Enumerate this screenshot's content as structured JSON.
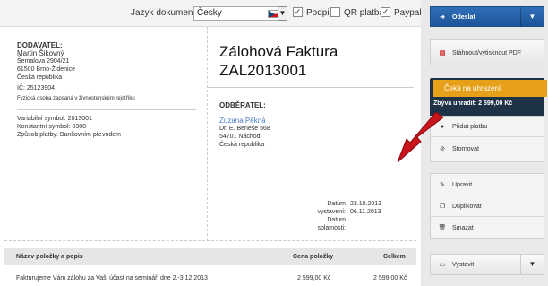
{
  "toolbar": {
    "language_label": "Jazyk dokumentu",
    "language_value": "Česky",
    "signature_label": "Podpis",
    "qr_label": "QR platba",
    "paypal_label": "Paypal"
  },
  "supplier": {
    "heading": "DODAVATEL:",
    "name": "Martin Šikovný",
    "street": "Šemalova 2904/21",
    "city": "61500 Brno-Židenice",
    "country": "Česká republika",
    "ic": "IČ: 25123904",
    "note": "Fyzická osoba zapsaná v živnostenském rejstříku"
  },
  "payment": {
    "variable": "Variabilní symbol: 2013001",
    "constant": "Konstantní symbol: 0308",
    "method": "Způsob platby: Bankovním převodem"
  },
  "invoice": {
    "title": "Zálohová Faktura",
    "number": "ZAL2013001"
  },
  "customer": {
    "heading": "ODBĚRATEL:",
    "name": "Zuzana Pěkná",
    "street": "Dr. E. Beneše 568",
    "city": "54701 Náchod",
    "country": "Česká republika"
  },
  "dates": {
    "issued_label": "Datum vystavení:",
    "issued": "23.10.2013",
    "due_label": "Datum splatnosti:",
    "due": "06.11.2013"
  },
  "table": {
    "col_name": "Název položky a popis",
    "col_price": "Cena položky",
    "col_total": "Celkem",
    "rows": [
      {
        "name": "Fakturujeme Vám zálohu za Vaši účast na semináři dne 2.-3.12.2013",
        "price": "2 599,00 Kč",
        "total": "2 599,00 Kč"
      }
    ]
  },
  "sidebar": {
    "send": "Odeslat",
    "pdf": "Stáhnout/vytisknout PDF",
    "status": "Čeká na uhrazení",
    "remaining": "Zbývá uhradit: 2 599,00 Kč",
    "add_payment": "Přidat platbu",
    "cancel": "Stornovat",
    "edit": "Upravit",
    "duplicate": "Duplikovat",
    "delete": "Smazat",
    "issue": "Vystavit"
  },
  "colors": {
    "accent": "#1e5499",
    "status": "#e6a01a",
    "panel_dark": "#1e3346",
    "arrow": "#c8141c"
  }
}
